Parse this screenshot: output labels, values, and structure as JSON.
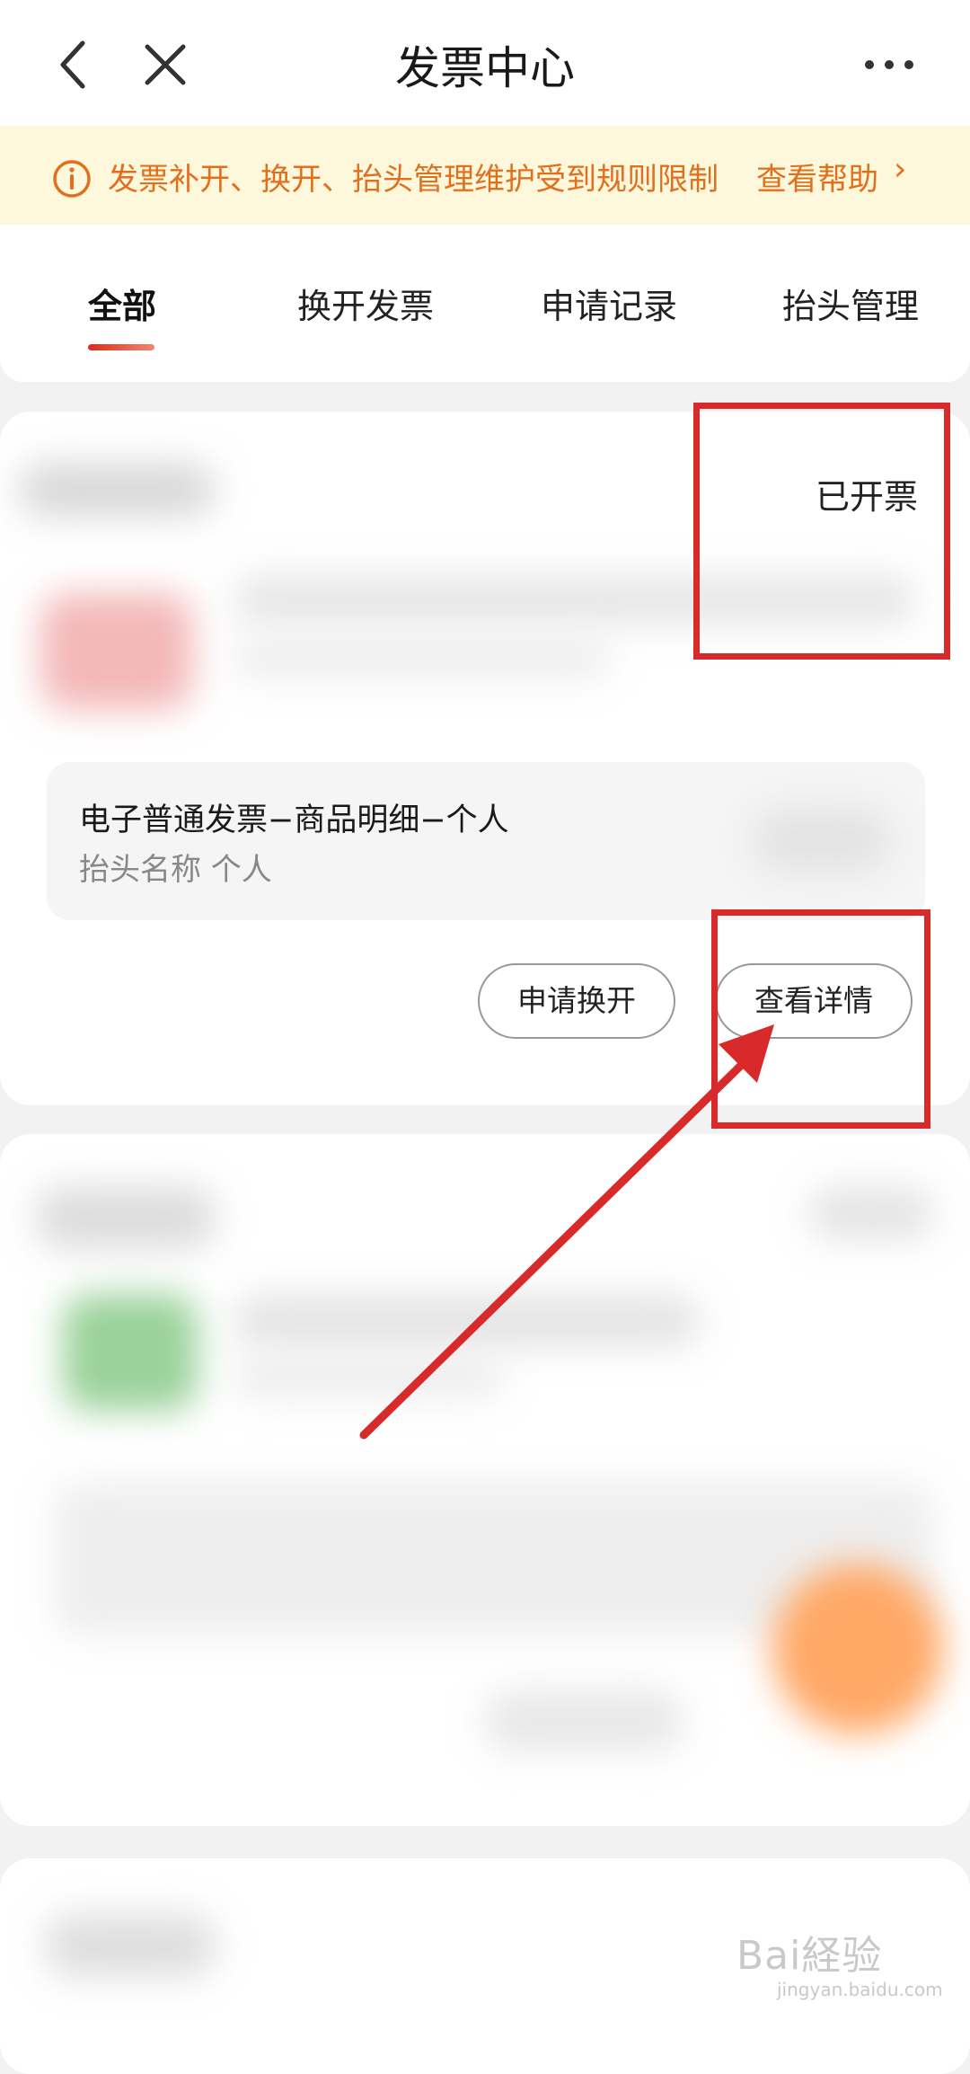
{
  "header": {
    "title": "发票中心",
    "back_icon": "chevron-left-icon",
    "close_icon": "close-icon",
    "more_icon": "more-horizontal-icon"
  },
  "notice": {
    "icon": "info-circle-icon",
    "text": "发票补开、换开、抬头管理维护受到规则限制",
    "link": "查看帮助",
    "arrow": "›",
    "color": "#e0701e",
    "background": "#fdf7dc"
  },
  "tabs": [
    {
      "label": "全部",
      "active": true
    },
    {
      "label": "换开发票",
      "active": false
    },
    {
      "label": "申请记录",
      "active": false
    },
    {
      "label": "抬头管理",
      "active": false
    }
  ],
  "order_card": {
    "status": "已开票",
    "invoice_type": "电子普通发票−商品明细−个人",
    "invoice_header": "抬头名称 个人",
    "buttons": {
      "reissue": "申请换开",
      "details": "查看详情"
    }
  },
  "watermark": {
    "brand": "Bai経验",
    "url": "jingyan.baidu.com"
  },
  "colors": {
    "accent": "#e02a18",
    "annotation": "#d82a2a"
  }
}
